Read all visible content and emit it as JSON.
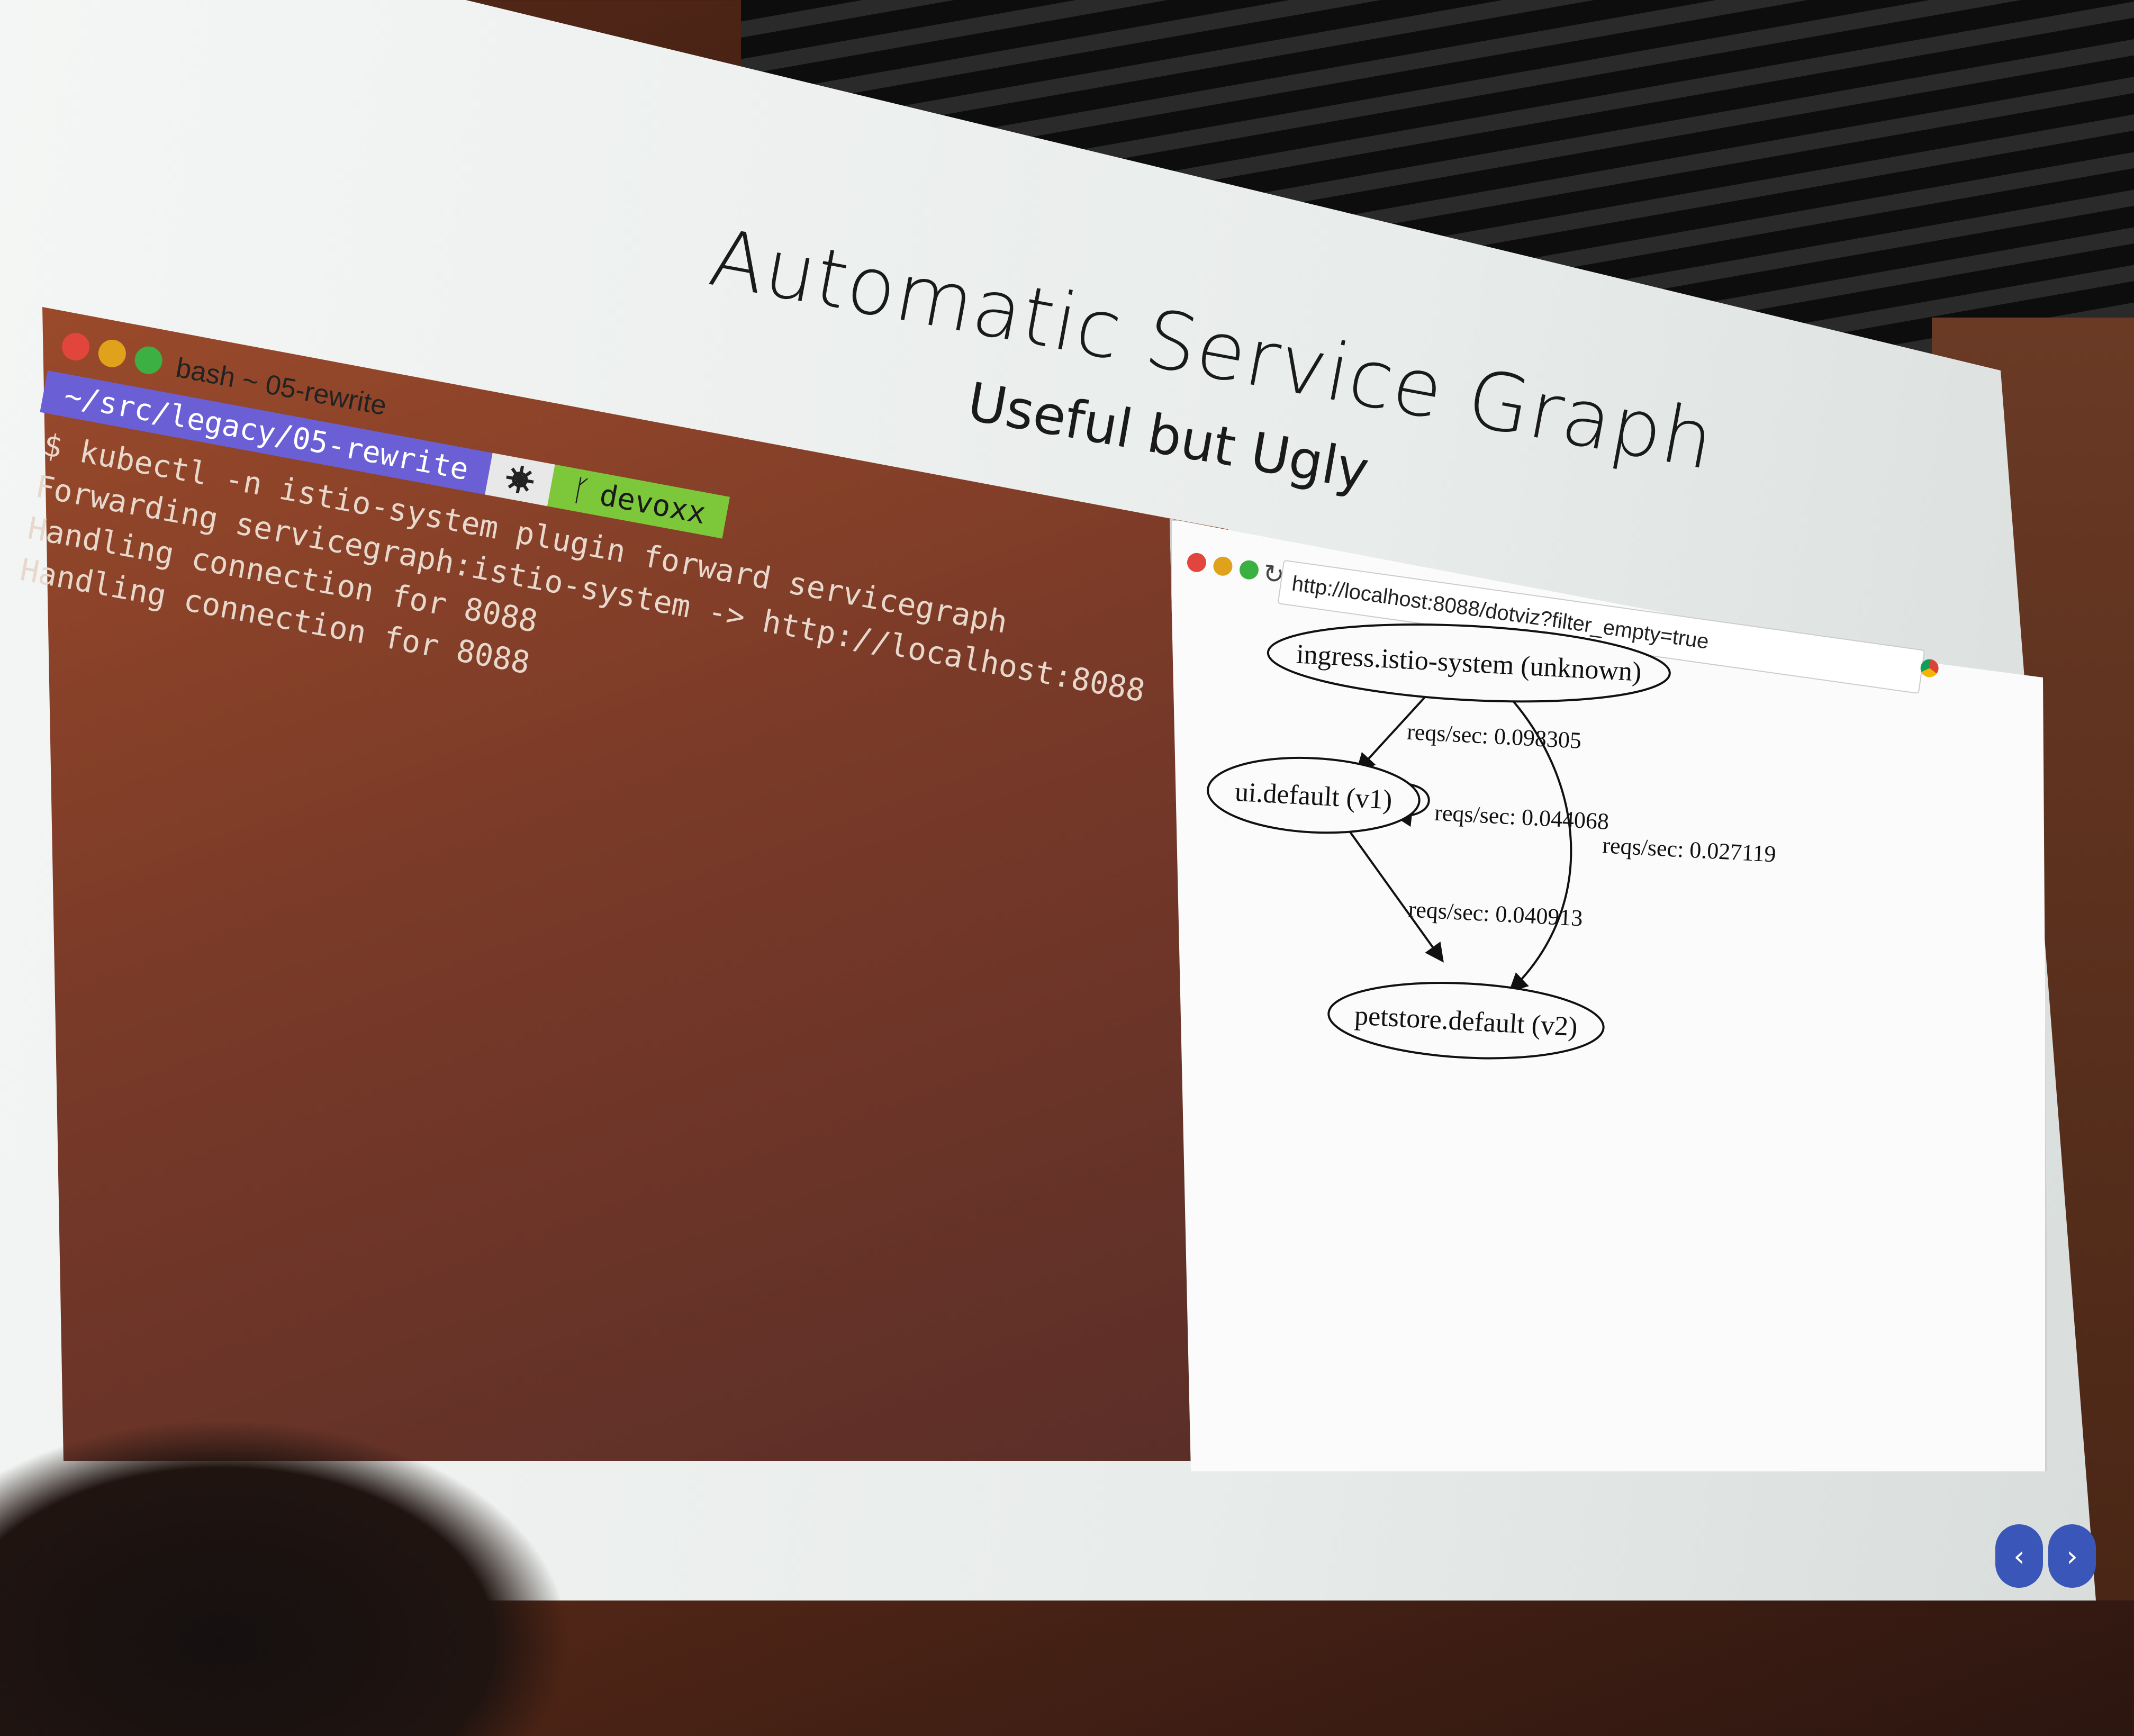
{
  "slide": {
    "title": "Automatic Service Graph",
    "subtitle": "Useful but Ugly"
  },
  "terminal": {
    "window_title": "bash ~ 05-rewrite",
    "traffic_lights": {
      "red": "#e2453c",
      "yellow": "#e0a11b",
      "green": "#3cb043"
    },
    "prompt": {
      "path": "~/src/legacy/05-rewrite",
      "path_color": "#6b5fd6",
      "k8s_icon": "kubernetes-helm-icon",
      "branch_icon": "git-branch-icon",
      "branch": "devoxx",
      "branch_color": "#7cc83a"
    },
    "lines": [
      "$ kubectl -n istio-system plugin forward servicegraph",
      "Forwarding servicegraph:istio-system -> http://localhost:8088",
      "Handling connection for 8088",
      "Handling connection for 8088"
    ]
  },
  "browser": {
    "reload_icon": "reload-icon",
    "url": "http://localhost:8088/dotviz?filter_empty=true",
    "extension_icon": "chrome-icon",
    "graph": {
      "nodes": [
        {
          "id": "ingress",
          "label": "ingress.istio-system (unknown)"
        },
        {
          "id": "ui",
          "label": "ui.default (v1)"
        },
        {
          "id": "petstore",
          "label": "petstore.default (v2)"
        }
      ],
      "edges": [
        {
          "from": "ingress",
          "to": "ui",
          "label": "reqs/sec: 0.098305"
        },
        {
          "from": "ui",
          "to": "ui",
          "label": "reqs/sec: 0.044068"
        },
        {
          "from": "ingress",
          "to": "petstore",
          "label": "reqs/sec: 0.027119"
        },
        {
          "from": "ui",
          "to": "petstore",
          "label": "reqs/sec: 0.040913"
        }
      ]
    }
  },
  "navigation": {
    "prev_label": "‹",
    "next_label": "›"
  }
}
